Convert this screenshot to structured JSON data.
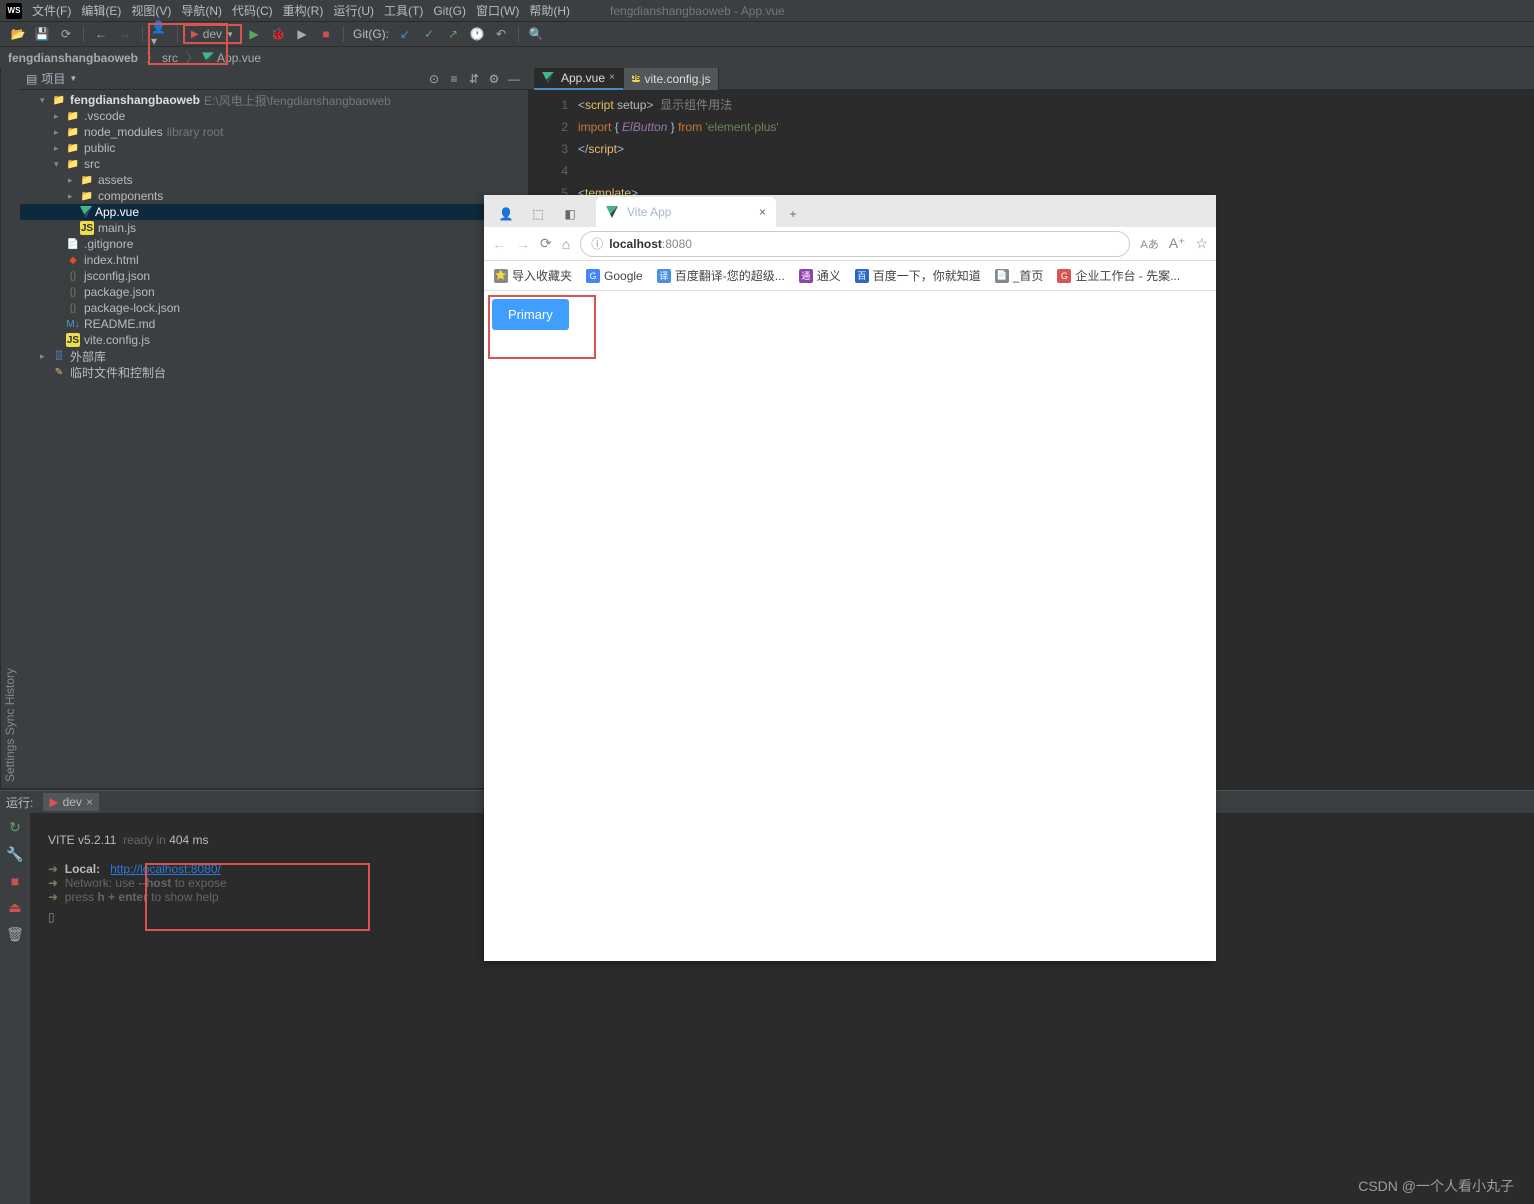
{
  "menubar": {
    "items": [
      "文件(F)",
      "编辑(E)",
      "视图(V)",
      "导航(N)",
      "代码(C)",
      "重构(R)",
      "运行(U)",
      "工具(T)",
      "Git(G)",
      "窗口(W)",
      "帮助(H)"
    ],
    "title": "fengdianshangbaoweb - App.vue"
  },
  "toolbar": {
    "runconf": "dev",
    "git_label": "Git(G):"
  },
  "breadcrumb": {
    "root": "fengdianshangbaoweb",
    "src": "src",
    "file": "App.vue"
  },
  "project": {
    "title": "项目",
    "root": "fengdianshangbaoweb",
    "root_path": "E:\\风电上报\\fengdianshangbaoweb",
    "items": [
      {
        "depth": 1,
        "arrow": "▾",
        "icon": "folder",
        "name": "fengdianshangbaoweb",
        "extra": "E:\\风电上报\\fengdianshangbaoweb",
        "bold": true
      },
      {
        "depth": 2,
        "arrow": "▸",
        "icon": "folder",
        "name": ".vscode"
      },
      {
        "depth": 2,
        "arrow": "▸",
        "icon": "folder-orange",
        "name": "node_modules",
        "extra": "library root"
      },
      {
        "depth": 2,
        "arrow": "▸",
        "icon": "folder",
        "name": "public"
      },
      {
        "depth": 2,
        "arrow": "▾",
        "icon": "folder",
        "name": "src"
      },
      {
        "depth": 3,
        "arrow": "▸",
        "icon": "folder",
        "name": "assets"
      },
      {
        "depth": 3,
        "arrow": "▸",
        "icon": "folder",
        "name": "components"
      },
      {
        "depth": 3,
        "arrow": "",
        "icon": "vue",
        "name": "App.vue",
        "sel": true
      },
      {
        "depth": 3,
        "arrow": "",
        "icon": "js",
        "name": "main.js"
      },
      {
        "depth": 2,
        "arrow": "",
        "icon": "file",
        "name": ".gitignore"
      },
      {
        "depth": 2,
        "arrow": "",
        "icon": "html",
        "name": "index.html"
      },
      {
        "depth": 2,
        "arrow": "",
        "icon": "json",
        "name": "jsconfig.json"
      },
      {
        "depth": 2,
        "arrow": "",
        "icon": "json",
        "name": "package.json"
      },
      {
        "depth": 2,
        "arrow": "",
        "icon": "json",
        "name": "package-lock.json"
      },
      {
        "depth": 2,
        "arrow": "",
        "icon": "md",
        "name": "README.md"
      },
      {
        "depth": 2,
        "arrow": "",
        "icon": "js",
        "name": "vite.config.js"
      }
    ],
    "ext_lib": "外部库",
    "scratch": "临时文件和控制台"
  },
  "left_tabs": [
    "Settings Sync History"
  ],
  "editor": {
    "tabs": [
      {
        "icon": "vue",
        "name": "App.vue",
        "active": true
      },
      {
        "icon": "js",
        "name": "vite.config.js"
      }
    ],
    "lines": [
      "1",
      "2",
      "3",
      "4",
      "5"
    ],
    "code_comment": "显示组件用法",
    "code_import": "ElButton",
    "code_from": "'element-plus'"
  },
  "run": {
    "label": "运行:",
    "tab": "dev",
    "vite": "VITE v5.2.11",
    "ready": "ready in",
    "time": "404 ms",
    "local_label": "Local:",
    "local_url": "http://localhost:8080/",
    "network": "Network: use",
    "network_flag": "--host",
    "network_rest": "to expose",
    "help": "press",
    "help_key": "h + enter",
    "help_rest": "to show help"
  },
  "browser": {
    "tab_title": "Vite App",
    "url_host": "localhost",
    "url_port": ":8080",
    "bookmarks": [
      {
        "icon": "⭐",
        "label": "导入收藏夹",
        "color": "#888"
      },
      {
        "icon": "G",
        "label": "Google",
        "color": "#4285f4"
      },
      {
        "icon": "译",
        "label": "百度翻译-您的超级...",
        "color": "#4a90e2"
      },
      {
        "icon": "通",
        "label": "通义",
        "color": "#8e44ad"
      },
      {
        "icon": "百",
        "label": "百度一下，你就知道",
        "color": "#2a67c9"
      },
      {
        "icon": "📄",
        "label": "_首页",
        "color": "#888"
      },
      {
        "icon": "G",
        "label": "企业工作台 - 先案...",
        "color": "#d9534f"
      }
    ],
    "button": "Primary"
  },
  "watermark": "CSDN @一个人看小丸子"
}
